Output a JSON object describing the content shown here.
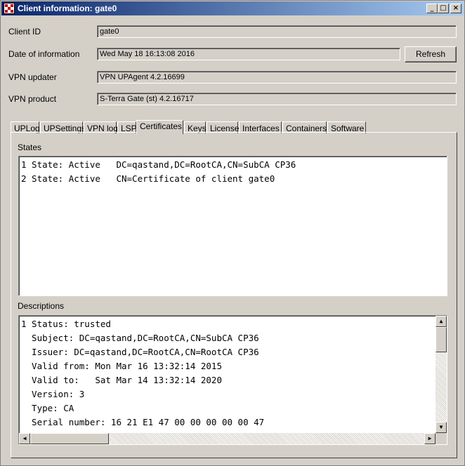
{
  "window": {
    "title": "Client information: gate0",
    "controls": {
      "minimize": "_",
      "maximize": "□",
      "close": "×"
    }
  },
  "form": {
    "client_id": {
      "label": "Client ID",
      "value": "gate0"
    },
    "date": {
      "label": "Date of information",
      "value": "Wed May 18 16:13:08 2016"
    },
    "updater": {
      "label": "VPN updater",
      "value": "VPN UPAgent 4.2.16699"
    },
    "product": {
      "label": "VPN product",
      "value": "S-Terra Gate (st) 4.2.16717"
    },
    "refresh_label": "Refresh"
  },
  "tabs": [
    {
      "label": "UPLog"
    },
    {
      "label": "UPSettings"
    },
    {
      "label": "VPN log"
    },
    {
      "label": "LSP"
    },
    {
      "label": "Certificates",
      "active": true
    },
    {
      "label": "Keys"
    },
    {
      "label": "License"
    },
    {
      "label": "Interfaces"
    },
    {
      "label": "Containers"
    },
    {
      "label": "Software"
    }
  ],
  "states": {
    "label": "States",
    "lines": [
      "1 State: Active   DC=qastand,DC=RootCA,CN=SubCA CP36",
      "2 State: Active   CN=Certificate of client gate0"
    ]
  },
  "descriptions": {
    "label": "Descriptions",
    "lines": [
      "1 Status: trusted",
      "  Subject: DC=qastand,DC=RootCA,CN=SubCA CP36",
      "  Issuer: DC=qastand,DC=RootCA,CN=RootCA CP36",
      "  Valid from: Mon Mar 16 13:32:14 2015",
      "  Valid to:   Sat Mar 14 13:32:14 2020",
      "  Version: 3",
      "  Type: CA",
      "  Serial number: 16 21 E1 47 00 00 00 00 00 47"
    ]
  },
  "scrollbar_glyphs": {
    "up": "▲",
    "down": "▼",
    "left": "◀",
    "right": "▶"
  }
}
